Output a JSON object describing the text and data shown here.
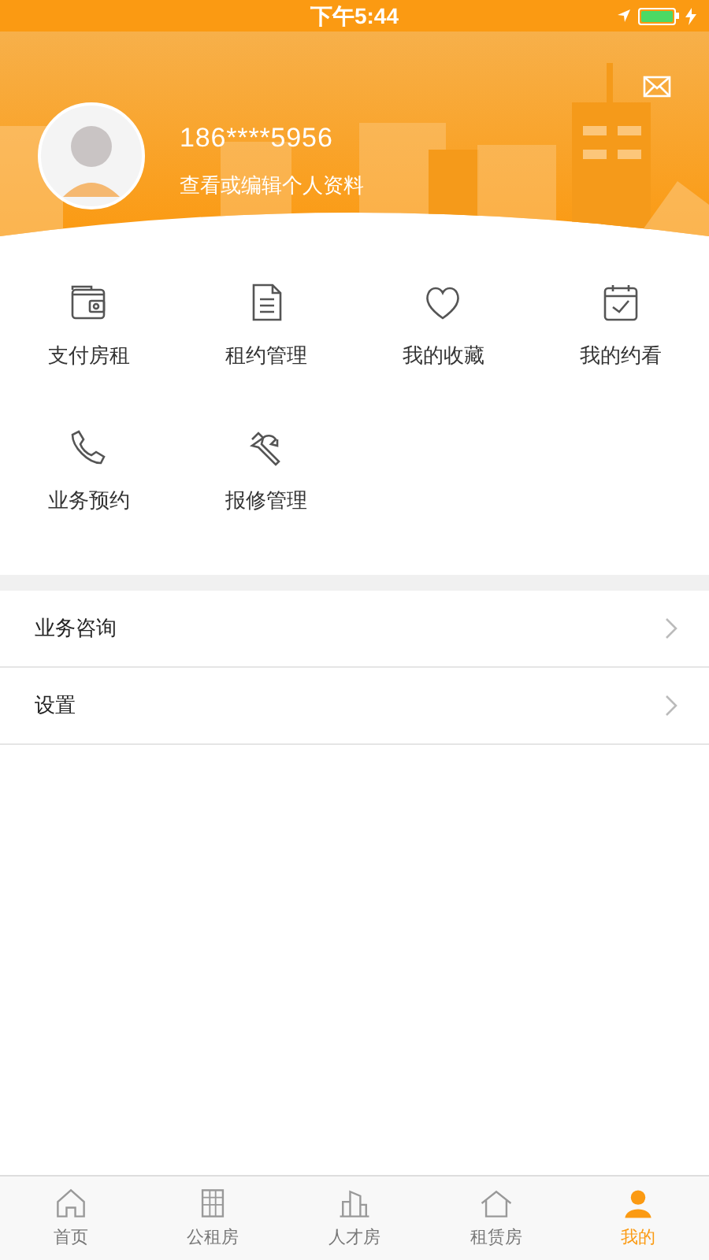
{
  "status_bar": {
    "time": "下午5:44"
  },
  "profile": {
    "phone": "186****5956",
    "link": "查看或编辑个人资料"
  },
  "features": [
    {
      "label": "支付房租",
      "kind": "wallet"
    },
    {
      "label": "租约管理",
      "kind": "document"
    },
    {
      "label": "我的收藏",
      "kind": "heart"
    },
    {
      "label": "我的约看",
      "kind": "calendar"
    },
    {
      "label": "业务预约",
      "kind": "phone"
    },
    {
      "label": "报修管理",
      "kind": "wrench"
    }
  ],
  "menu": [
    {
      "label": "业务咨询"
    },
    {
      "label": "设置"
    }
  ],
  "tab_bar": [
    {
      "label": "首页",
      "kind": "home",
      "selected": false
    },
    {
      "label": "公租房",
      "kind": "building",
      "selected": false
    },
    {
      "label": "人才房",
      "kind": "tower",
      "selected": false
    },
    {
      "label": "租赁房",
      "kind": "house",
      "selected": false
    },
    {
      "label": "我的",
      "kind": "person",
      "selected": true
    }
  ]
}
